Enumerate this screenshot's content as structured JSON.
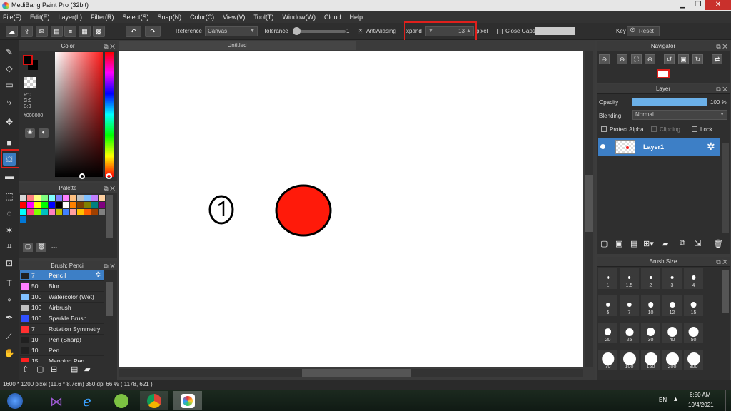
{
  "window": {
    "title": "MediBang Paint Pro (32bit)",
    "min": "▁",
    "max": "❐",
    "close": "✕"
  },
  "menu": [
    "File(F)",
    "Edit(E)",
    "Layer(L)",
    "Filter(R)",
    "Select(S)",
    "Snap(N)",
    "Color(C)",
    "View(V)",
    "Tool(T)",
    "Window(W)",
    "Cloud",
    "Help"
  ],
  "toolbar": {
    "reference_label": "Reference",
    "reference_value": "Canvas",
    "tolerance_label": "Tolerance",
    "tolerance_value": "1",
    "tolerance_fraction": 0.02,
    "antialiasing_label": "AntiAliasing",
    "antialiasing_checked": true,
    "expand_label": "xpand",
    "expand_value": "13",
    "expand_unit": "pixel",
    "close_gaps_label": "Close Gaps",
    "close_gaps_checked": false,
    "key_label": "Key",
    "reset_label": "Reset"
  },
  "color_panel": {
    "title": "Color",
    "r": "R:0",
    "g": "G:0",
    "b": "B:0",
    "hex": "#000000",
    "accent": "#e0201c"
  },
  "palette_panel": {
    "title": "Palette",
    "footer_text": "---",
    "colors": [
      "#d8d8d8",
      "#ff8080",
      "#ffff80",
      "#80ff80",
      "#80ffff",
      "#8080ff",
      "#ff80ff",
      "#ffc080",
      "#c0c0c0",
      "#80c0ff",
      "#c080ff",
      "#ffd0a0",
      "#ff0000",
      "#ff00ff",
      "#ffff00",
      "#00ff00",
      "#0000ff",
      "#000000",
      "#ffffff",
      "#ff8000",
      "#804000",
      "#808000",
      "#008080",
      "#800080",
      "#00ffff",
      "#ff4080",
      "#80ff00",
      "#00c0c0",
      "#ff80c0",
      "#c0c000",
      "#4080ff",
      "#ffa0a0",
      "#ffc000",
      "#ff6000",
      "#a04000",
      "#808080",
      "#0078d7"
    ]
  },
  "brush_panel": {
    "title": "Brush: Pencil",
    "brushes": [
      {
        "size": "7",
        "name": "Pencil",
        "color": "#202020"
      },
      {
        "size": "50",
        "name": "Blur",
        "color": "#ff80ff"
      },
      {
        "size": "100",
        "name": "Watercolor (Wet)",
        "color": "#80c0ff"
      },
      {
        "size": "100",
        "name": "Airbrush",
        "color": "#c0c0c0"
      },
      {
        "size": "100",
        "name": "Sparkle Brush",
        "color": "#3050ff"
      },
      {
        "size": "7",
        "name": "Rotation Symmetry",
        "color": "#ff3030"
      },
      {
        "size": "10",
        "name": "Pen (Sharp)",
        "color": "#202020"
      },
      {
        "size": "10",
        "name": "Pen",
        "color": "#202020"
      },
      {
        "size": "15",
        "name": "Mapping Pen",
        "color": "#ff2020"
      }
    ]
  },
  "document": {
    "tab": "Untitled"
  },
  "navigator": {
    "title": "Navigator"
  },
  "layer_panel": {
    "title": "Layer",
    "opacity_label": "Opacity",
    "opacity_value": "100 %",
    "opacity_fraction": 1.0,
    "blending_label": "Blending",
    "blending_value": "Normal",
    "protect_alpha": "Protect Alpha",
    "clipping": "Clipping",
    "lock": "Lock",
    "layer_name": "Layer1"
  },
  "brush_size_panel": {
    "title": "Brush Size",
    "sizes": [
      "1",
      "1.5",
      "2",
      "3",
      "4",
      "5",
      "7",
      "10",
      "12",
      "15",
      "20",
      "25",
      "30",
      "40",
      "50",
      "70",
      "100",
      "150",
      "200",
      "300"
    ]
  },
  "status": {
    "text": "1600 * 1200 pixel   (11.6 * 8.7cm)   350 dpi   66 %   ( 1178, 621 )"
  },
  "tray": {
    "lang": "EN",
    "time": "6:50 AM",
    "date": "10/4/2021"
  }
}
